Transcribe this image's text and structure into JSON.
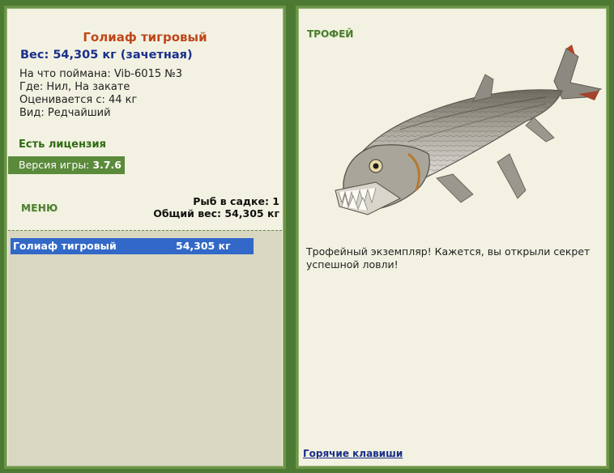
{
  "left": {
    "fish_name": "Голиаф тигровый",
    "weight_line": "Вес: 54,305 кг (зачетная)",
    "info": [
      "На что поймана: Vib-6015 №3",
      "Где: Нил, На закате",
      "Оценивается с: 44 кг",
      "Вид: Редчайший"
    ],
    "license": "Есть лицензия",
    "version_label": "Версия игры:",
    "version_value": "3.7.6",
    "menu_label": "МЕНЮ",
    "summary": {
      "count_line": "Рыб в садке: 1",
      "total_line": "Общий вес: 54,305 кг"
    },
    "catches": [
      {
        "name": "Голиаф тигровый",
        "weight": "54,305 кг"
      }
    ]
  },
  "right": {
    "trophy_label": "ТРОФЕЙ",
    "fish_image_icon": "tiger-fish-image",
    "trophy_text": "Трофейный экземпляр! Кажется, вы открыли секрет успешной ловли!",
    "hotkeys_link": "Горячие клавиши"
  },
  "colors": {
    "background": "#4d7a33",
    "panel": "#f3f2e2",
    "title": "#c0461a",
    "weight": "#1a2f8a",
    "selected_row": "#3268c8",
    "version_bar": "#5b8a3b"
  }
}
